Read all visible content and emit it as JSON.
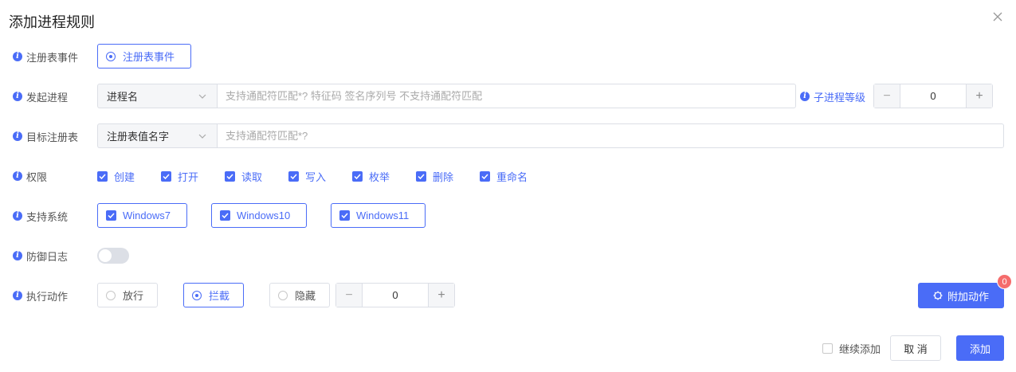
{
  "dialog": {
    "title": "添加进程规则"
  },
  "registry_event": {
    "label": "注册表事件",
    "option": "注册表事件"
  },
  "initiating_process": {
    "label": "发起进程",
    "select_value": "进程名",
    "input_placeholder": "支持通配符匹配*? 特征码 签名序列号 不支持通配符匹配",
    "child_level_label": "子进程等级",
    "child_level_value": "0"
  },
  "target_registry": {
    "label": "目标注册表",
    "select_value": "注册表值名字",
    "input_placeholder": "支持通配符匹配*?"
  },
  "permissions": {
    "label": "权限",
    "items": [
      "创建",
      "打开",
      "读取",
      "写入",
      "枚举",
      "删除",
      "重命名"
    ]
  },
  "systems": {
    "label": "支持系统",
    "items": [
      "Windows7",
      "Windows10",
      "Windows11"
    ]
  },
  "defense_log": {
    "label": "防御日志",
    "enabled": false
  },
  "action": {
    "label": "执行动作",
    "options": [
      "放行",
      "拦截",
      "隐藏"
    ],
    "selected": "拦截",
    "stepper_value": "0",
    "attach_button": "附加动作",
    "attach_badge": "0"
  },
  "footer": {
    "continue_label": "继续添加",
    "cancel_label": "取 消",
    "add_label": "添加"
  },
  "colors": {
    "primary": "#4a6cf7",
    "badge": "#f56c6c"
  }
}
